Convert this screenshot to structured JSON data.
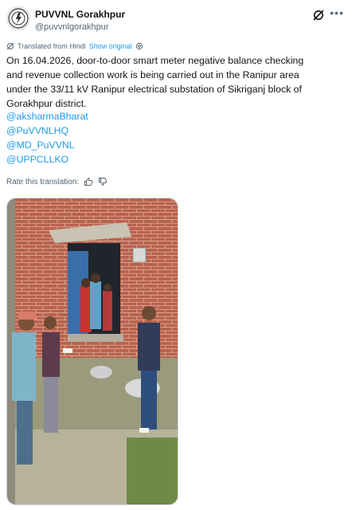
{
  "account": {
    "name": "PUVVNL Gorakhpur",
    "handle": "@puvvnlgorakhpur"
  },
  "translation": {
    "from_text": "Translated from Hindi",
    "show_original": "Show original",
    "rate_text": "Rate this translation:"
  },
  "post": {
    "line1": "On 16.04.2026, door-to-door smart meter negative balance checking",
    "line2": "and revenue collection work is being carried out in the Ranipur area",
    "line3": "under the 33/11 kV Ranipur electrical substation of Sikriganj block of",
    "line4": "Gorakhpur district.",
    "mentions": [
      "@aksharmaBharat",
      "@PuVVNLHQ",
      "@MD_PuVVNL",
      "@UPPCLLKO"
    ]
  },
  "icons": [
    "grok-icon",
    "more-options-icon",
    "translate-icon",
    "settings-icon",
    "thumbs-up-icon",
    "thumbs-down-icon"
  ],
  "colors": {
    "link": "#1d9bf0",
    "secondary": "#536471",
    "text": "#0f1419"
  }
}
